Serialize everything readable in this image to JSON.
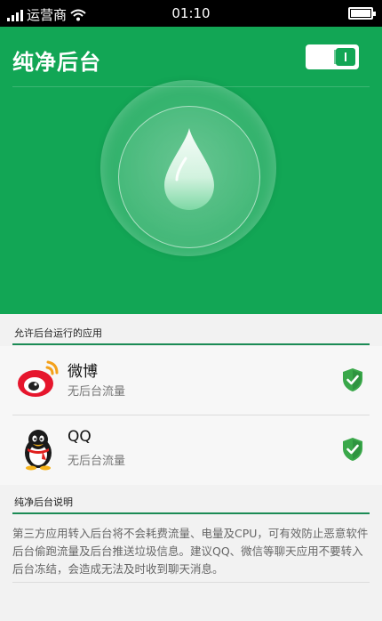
{
  "status_bar": {
    "carrier": "运营商",
    "time": "01:10"
  },
  "header": {
    "title": "纯净后台",
    "toggle_state": "on"
  },
  "allowed_section": {
    "title": "允许后台运行的应用",
    "apps": [
      {
        "name": "微博",
        "subtitle": "无后台流量",
        "icon": "weibo-icon"
      },
      {
        "name": "QQ",
        "subtitle": "无后台流量",
        "icon": "qq-icon"
      }
    ]
  },
  "info_section": {
    "title": "纯净后台说明",
    "description": "第三方应用转入后台将不会耗费流量、电量及CPU，可有效防止恶意软件后台偷跑流量及后台推送垃圾信息。建议QQ、微信等聊天应用不要转入后台冻结，会造成无法及时收到聊天消息。"
  },
  "colors": {
    "brand_green": "#12a655",
    "section_underline": "#1b8b55",
    "shield_green": "#3aa84a"
  }
}
